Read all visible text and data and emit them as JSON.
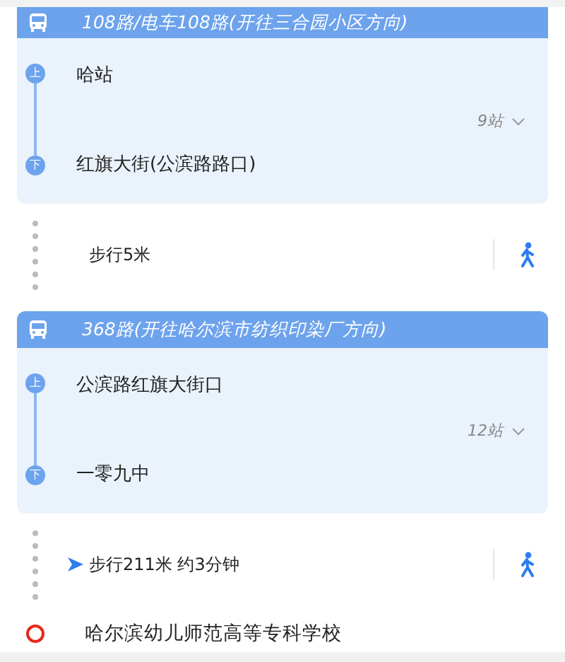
{
  "segments": [
    {
      "kind": "bus",
      "title": "108路/电车108路(开往三合园小区方向)",
      "board_marker": "上",
      "board_stop": "哈站",
      "stop_count": "9站",
      "alight_marker": "下",
      "alight_stop": "红旗大街(公滨路路口)"
    },
    {
      "kind": "walk",
      "text": "步行5米",
      "has_arrow": false
    },
    {
      "kind": "bus",
      "title": "368路(开往哈尔滨市纺织印染厂方向)",
      "board_marker": "上",
      "board_stop": "公滨路红旗大街口",
      "stop_count": "12站",
      "alight_marker": "下",
      "alight_stop": "一零九中"
    },
    {
      "kind": "walk",
      "text": "步行211米 约3分钟",
      "has_arrow": true
    },
    {
      "kind": "destination",
      "text": "哈尔滨幼儿师范高等专科学校"
    }
  ]
}
